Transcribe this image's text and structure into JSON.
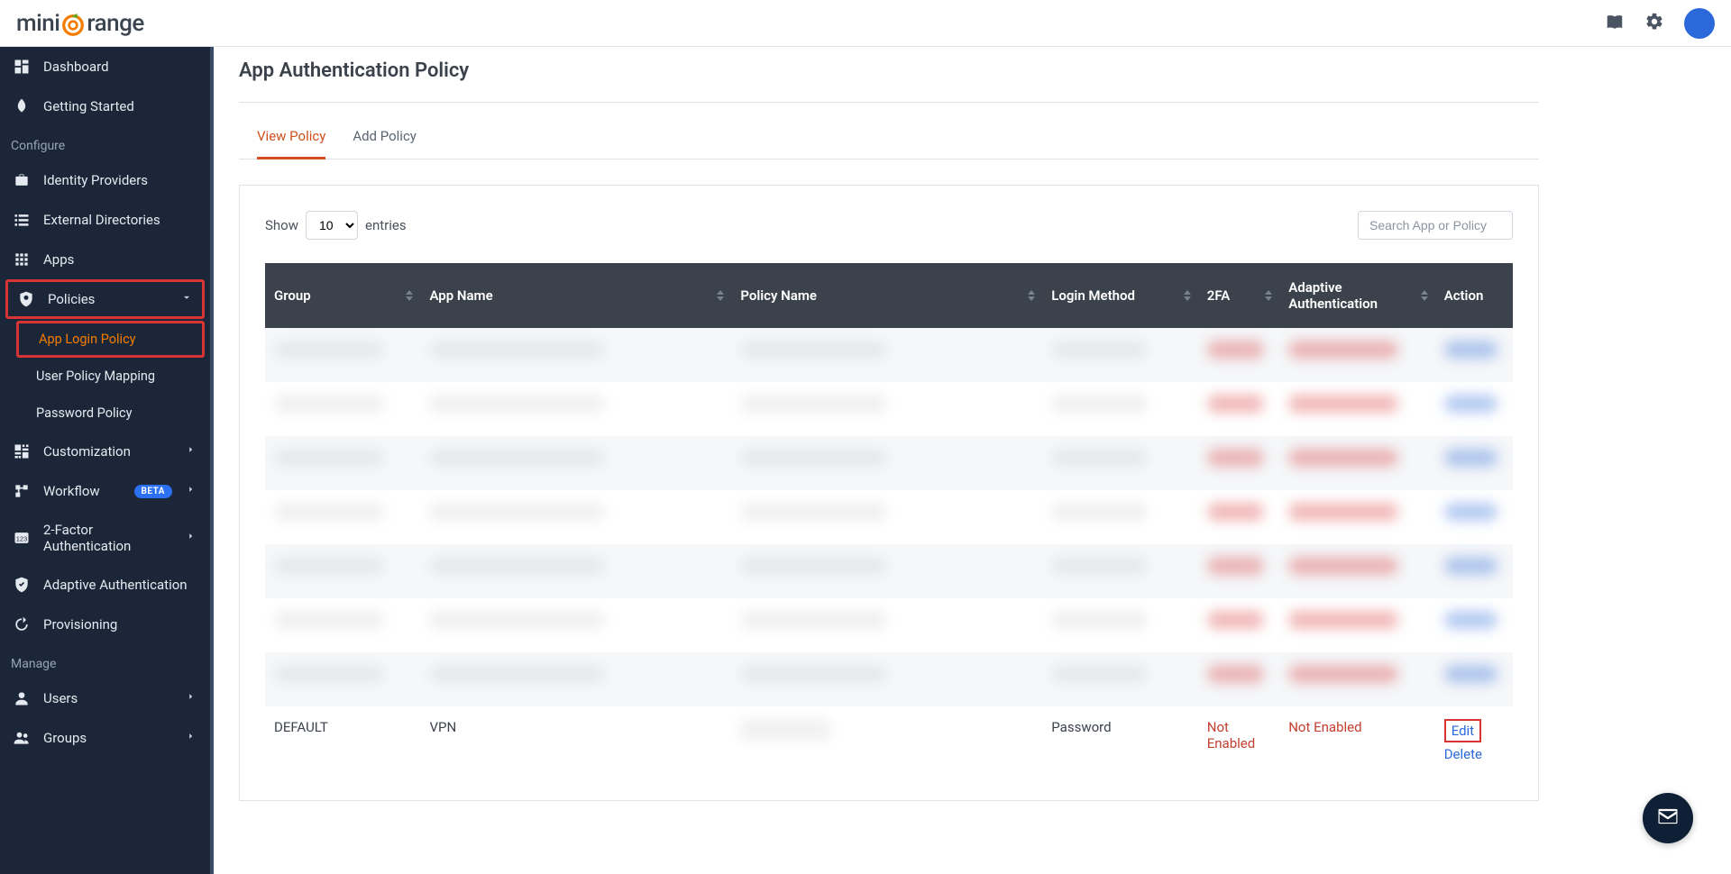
{
  "brand": {
    "name_left": "mini",
    "name_right": "range"
  },
  "topbar": {
    "book_icon": "menu-book-icon",
    "settings_icon": "gear-icon"
  },
  "sidebar": {
    "items": [
      {
        "icon": "dashboard-icon",
        "label": "Dashboard",
        "caret": null
      },
      {
        "icon": "rocket-icon",
        "label": "Getting Started",
        "caret": null
      }
    ],
    "section1_label": "Configure",
    "configure": [
      {
        "icon": "briefcase-icon",
        "label": "Identity Providers"
      },
      {
        "icon": "list-icon",
        "label": "External Directories"
      },
      {
        "icon": "apps-icon",
        "label": "Apps"
      },
      {
        "icon": "shield-icon",
        "label": "Policies",
        "caret": "down",
        "highlighted": true,
        "children": [
          {
            "label": "App Login Policy",
            "active": true,
            "highlighted": true
          },
          {
            "label": "User Policy Mapping"
          },
          {
            "label": "Password Policy"
          }
        ]
      },
      {
        "icon": "customize-icon",
        "label": "Customization",
        "caret": "right"
      },
      {
        "icon": "workflow-icon",
        "label": "Workflow",
        "badge": "BETA",
        "caret": "right"
      },
      {
        "icon": "twofa-icon",
        "label": "2-Factor Authentication",
        "caret": "right"
      },
      {
        "icon": "shieldcheck-icon",
        "label": "Adaptive Authentication"
      },
      {
        "icon": "provision-icon",
        "label": "Provisioning"
      }
    ],
    "section2_label": "Manage",
    "manage": [
      {
        "icon": "person-icon",
        "label": "Users",
        "caret": "right"
      },
      {
        "icon": "people-icon",
        "label": "Groups",
        "caret": "right"
      }
    ]
  },
  "page": {
    "title": "App Authentication Policy",
    "tabs": [
      {
        "label": "View Policy",
        "active": true
      },
      {
        "label": "Add Policy"
      }
    ],
    "entries": {
      "show_label": "Show",
      "entries_label": "entries",
      "page_size": "10",
      "search_placeholder": "Search App or Policy"
    },
    "columns": [
      "Group",
      "App Name",
      "Policy Name",
      "Login Method",
      "2FA",
      "Adaptive Authentication",
      "Action"
    ],
    "blurred_row_count": 7,
    "last_row": {
      "group": "DEFAULT",
      "app_name": "VPN",
      "policy_name_hidden": true,
      "login_method": "Password",
      "twofa": "Not Enabled",
      "adaptive": "Not Enabled",
      "action_edit": "Edit",
      "action_delete": "Delete"
    }
  },
  "fab": {
    "icon": "mail-icon"
  }
}
